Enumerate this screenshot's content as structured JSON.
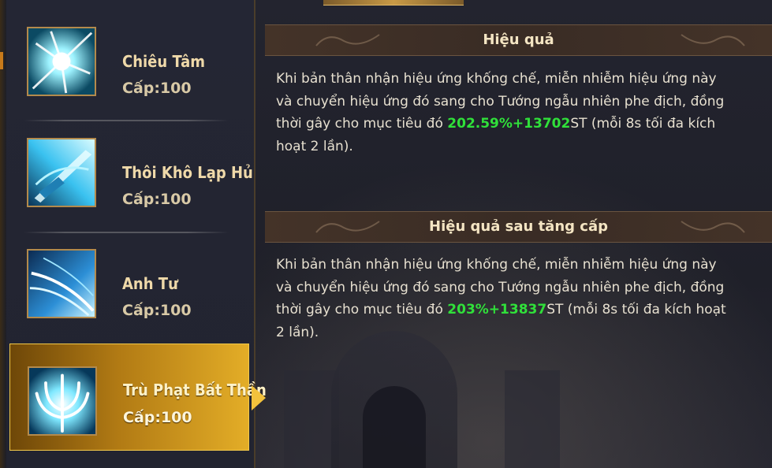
{
  "skills": [
    {
      "name": "Chiêu Tâm",
      "level": "Cấp:100",
      "icon": "starburst-icon",
      "selected": false
    },
    {
      "name": "Thôi Khô Lạp Hủ",
      "level": "Cấp:100",
      "icon": "sword-icon",
      "selected": false
    },
    {
      "name": "Anh Tư",
      "level": "Cấp:100",
      "icon": "slash-icon",
      "selected": false
    },
    {
      "name": "Trù Phạt Bất Thần",
      "level": "Cấp:100",
      "icon": "trident-icon",
      "selected": true
    }
  ],
  "effect": {
    "title": "Hiệu quả",
    "text_before": "Khi bản thân nhận hiệu ứng khống chế, miễn nhiễm hiệu ứng này và chuyển hiệu ứng đó sang cho Tướng ngẫu nhiên phe địch, đồng thời gây cho mục tiêu đó ",
    "highlight": "202.59%+13702",
    "text_after": "ST (mỗi 8s tối đa kích hoạt 2 lần)."
  },
  "next_effect": {
    "title": "Hiệu quả sau tăng cấp",
    "text_before": "Khi bản thân nhận hiệu ứng khống chế, miễn nhiễm hiệu ứng này và chuyển hiệu ứng đó sang cho Tướng ngẫu nhiên phe địch, đồng thời gây cho mục tiêu đó ",
    "highlight": "203%+13837",
    "text_after": "ST (mỗi 8s tối đa kích hoạt 2 lần)."
  },
  "colors": {
    "highlight": "#30e03a",
    "selected_gold": "#e3ad27",
    "text": "#e7e0d0"
  }
}
